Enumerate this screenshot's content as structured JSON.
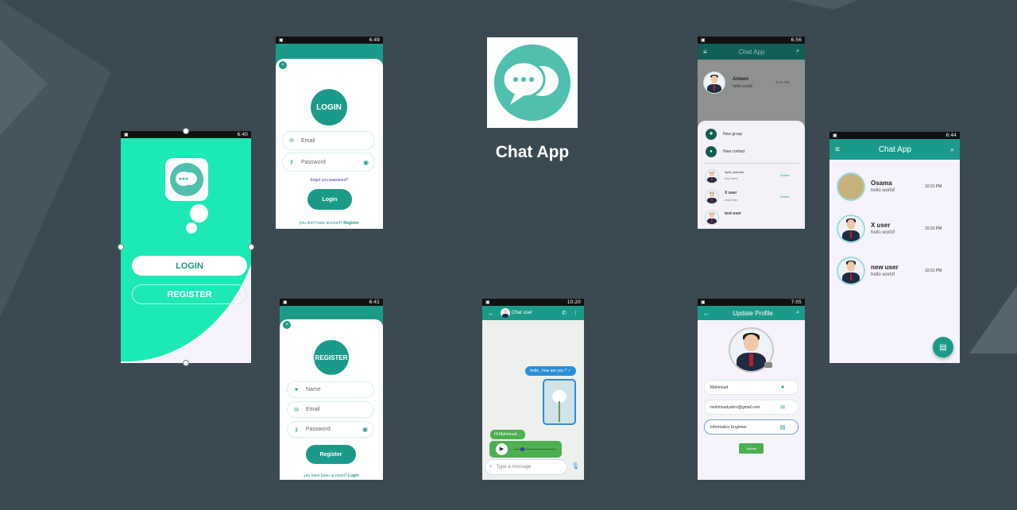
{
  "center": {
    "title": "Chat App"
  },
  "login_phone": {
    "time": "6:49",
    "title": "LOGIN",
    "email_placeholder": "Email",
    "password_placeholder": "Password",
    "forgot": "forget you password?",
    "login_btn": "Login",
    "no_account": "you don't have account?",
    "register_link": "Register"
  },
  "splash_phone": {
    "time": "6:40",
    "login_btn": "LOGIN",
    "register_btn": "REGISTER"
  },
  "register_phone": {
    "time": "6:41",
    "title": "REGISTER",
    "name_placeholder": "Name",
    "email_placeholder": "Email",
    "password_placeholder": "Password",
    "register_btn": "Register",
    "have_account": "you have been account?",
    "login_link": "Login"
  },
  "chat_phone": {
    "time": "10:20",
    "user": "Chat user",
    "msg_out": "hello , how are you ? ✓",
    "msg_in": "Hi Mahmoud ...",
    "input_placeholder": "Type a message"
  },
  "menu_phone": {
    "time": "6:56",
    "title": "Chat App",
    "top_name": "Ameen",
    "top_msg": "hello world!",
    "top_time": "10:31 PM",
    "new_group": "New group",
    "new_contact": "New contact",
    "users": [
      {
        "name": "ayah_pekaan",
        "sub": "hey there",
        "status": "Online"
      },
      {
        "name": "X user",
        "sub": "chat user",
        "status": "Online"
      },
      {
        "name": "test user",
        "sub": "",
        "status": ""
      }
    ]
  },
  "profile_phone": {
    "time": "7:05",
    "title": "Update Profile",
    "name": "Mahmoud",
    "email": "mahmoudyahro@gmail.com",
    "job": "Informatics Engineer",
    "upload": "Upload"
  },
  "list_phone": {
    "time": "6:44",
    "title": "Chat App",
    "chats": [
      {
        "name": "Osama",
        "msg": "hello world!",
        "time": "10:31 PM"
      },
      {
        "name": "X user",
        "msg": "hello world!",
        "time": "10:31 PM"
      },
      {
        "name": "new user",
        "msg": "hello world!",
        "time": "10:31 PM"
      }
    ]
  },
  "colors": {
    "bg": "#3b4a52",
    "teal": "#1a9b8a",
    "mint": "#1de9b6",
    "green": "#4caf50"
  }
}
